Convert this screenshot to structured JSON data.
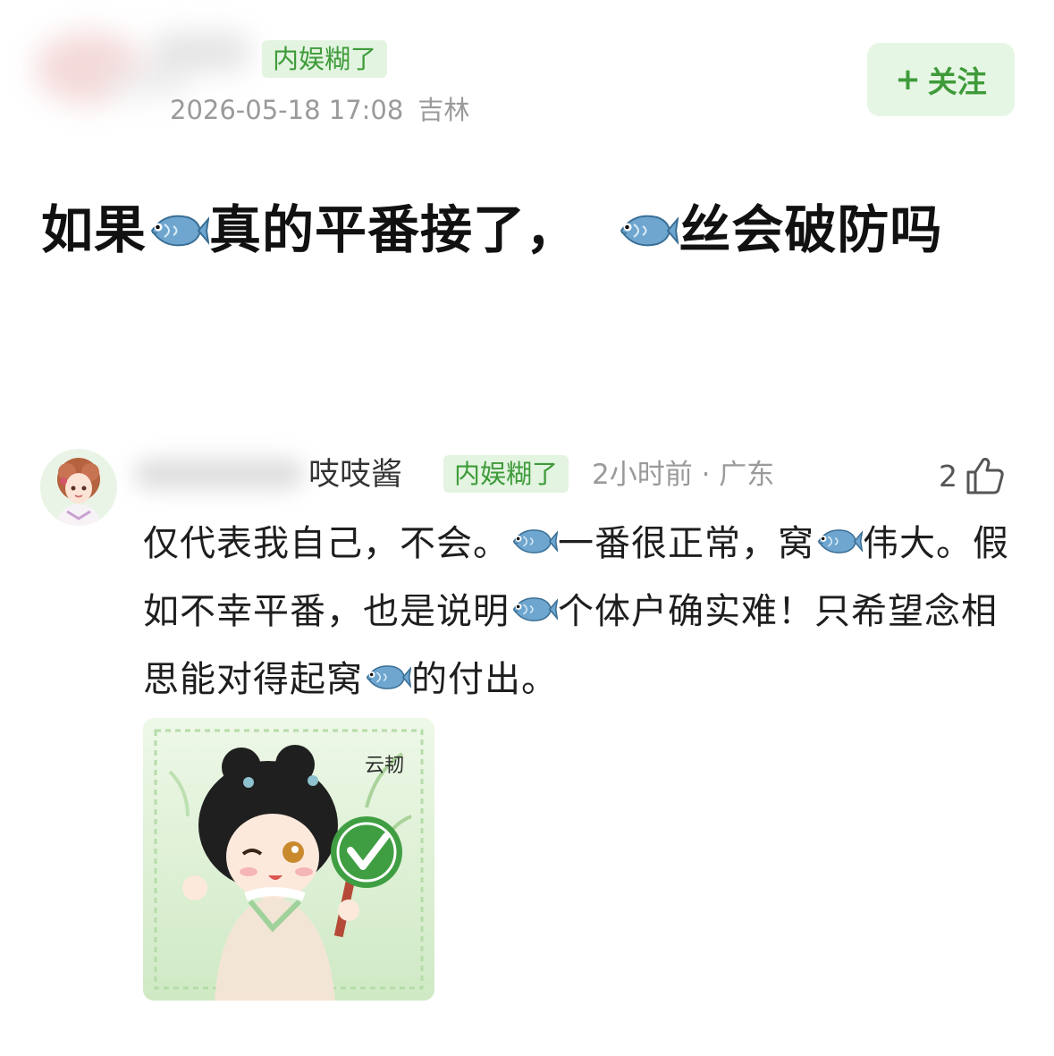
{
  "post": {
    "tag": "内娱糊了",
    "date": "2026-05-18 17:08",
    "location": "吉林",
    "follow_plus": "+",
    "follow_label": "关注",
    "title_parts": [
      "如果",
      "真的平番接了，",
      "丝会破防吗"
    ]
  },
  "comment": {
    "name_suffix": "吱吱酱",
    "tag": "内娱糊了",
    "meta": "2小时前 · 广东",
    "likes": "2",
    "text_parts": [
      "仅代表我自己，不会。",
      "一番很正常，窝",
      "伟大。假如不幸平番，也是说明",
      "个体户确实难！只希望念相思能对得起窝",
      "的付出。"
    ],
    "sticker_text": "云韧"
  },
  "icons": {
    "fish": "fish-emoji-icon",
    "like": "thumbs-up-icon",
    "check": "check-icon"
  },
  "colors": {
    "accent_green": "#3f9b3a",
    "tag_bg": "#e3f4e1",
    "meta_gray": "#9a9a9a",
    "fish_blue": "#6ea6cf"
  }
}
